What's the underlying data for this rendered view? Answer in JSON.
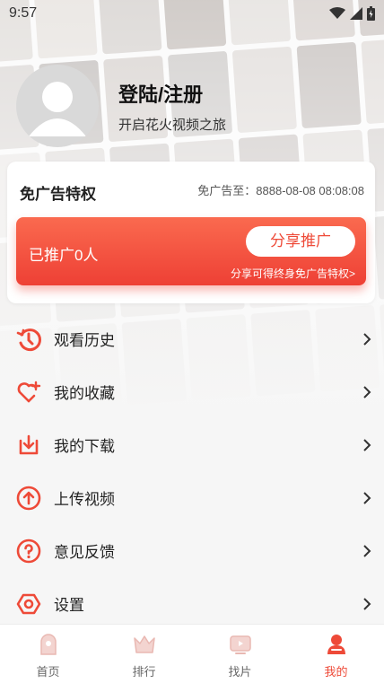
{
  "status_bar": {
    "time": "9:57"
  },
  "profile": {
    "title": "登陆/注册",
    "subtitle": "开启花火视频之旅"
  },
  "ad_free_card": {
    "title": "免广告特权",
    "expire_text": "免广告至：8888-08-08 08:08:08",
    "promo": {
      "count_text": "已推广0人",
      "share_button": "分享推广",
      "hint": "分享可得终身免广告特权>"
    }
  },
  "menu": {
    "items": [
      {
        "label": "观看历史",
        "icon": "history-icon"
      },
      {
        "label": "我的收藏",
        "icon": "heart-plus-icon"
      },
      {
        "label": "我的下载",
        "icon": "download-icon"
      },
      {
        "label": "上传视频",
        "icon": "upload-icon"
      },
      {
        "label": "意见反馈",
        "icon": "help-icon"
      },
      {
        "label": "设置",
        "icon": "settings-icon"
      }
    ]
  },
  "tabbar": {
    "tabs": [
      {
        "label": "首页",
        "icon": "home-icon"
      },
      {
        "label": "排行",
        "icon": "crown-icon"
      },
      {
        "label": "找片",
        "icon": "tv-icon"
      },
      {
        "label": "我的",
        "icon": "person-icon"
      }
    ],
    "active_tab": "我的"
  },
  "colors": {
    "accent": "#ee4a38",
    "accent_light": "#fa6a4f"
  }
}
